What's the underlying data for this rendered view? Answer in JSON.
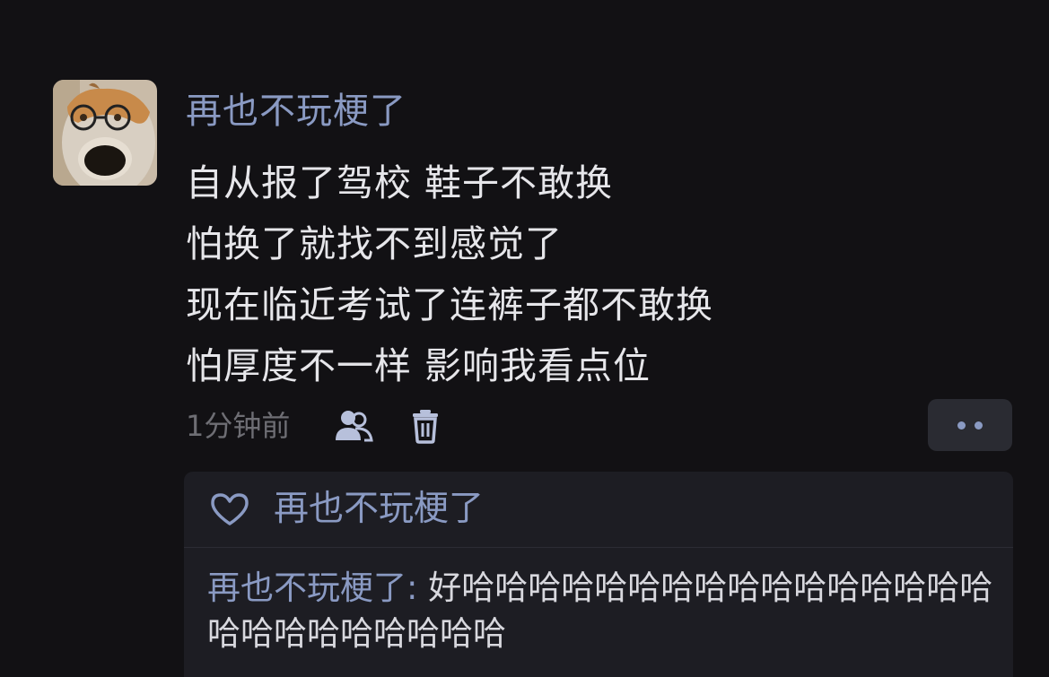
{
  "post": {
    "username": "再也不玩梗了",
    "lines": [
      "自从报了驾校 鞋子不敢换",
      "怕换了就找不到感觉了",
      "现在临近考试了连裤子都不敢换",
      "怕厚度不一样 影响我看点位"
    ],
    "time": "1分钟前",
    "icons": {
      "visibility": "friends-icon",
      "delete": "trash-icon",
      "more": "more-dots-icon",
      "like": "heart-icon"
    }
  },
  "likes": {
    "names": "再也不玩梗了"
  },
  "comment": {
    "author": "再也不玩梗了",
    "separator": ": ",
    "text": "好哈哈哈哈哈哈哈哈哈哈哈哈哈哈哈哈哈哈哈哈哈哈哈哈哈"
  },
  "colors": {
    "background": "#121114",
    "accent": "#8a9ac3",
    "text": "#e6e6ea",
    "muted": "#6e6e74",
    "panel": "#1d1d23"
  }
}
